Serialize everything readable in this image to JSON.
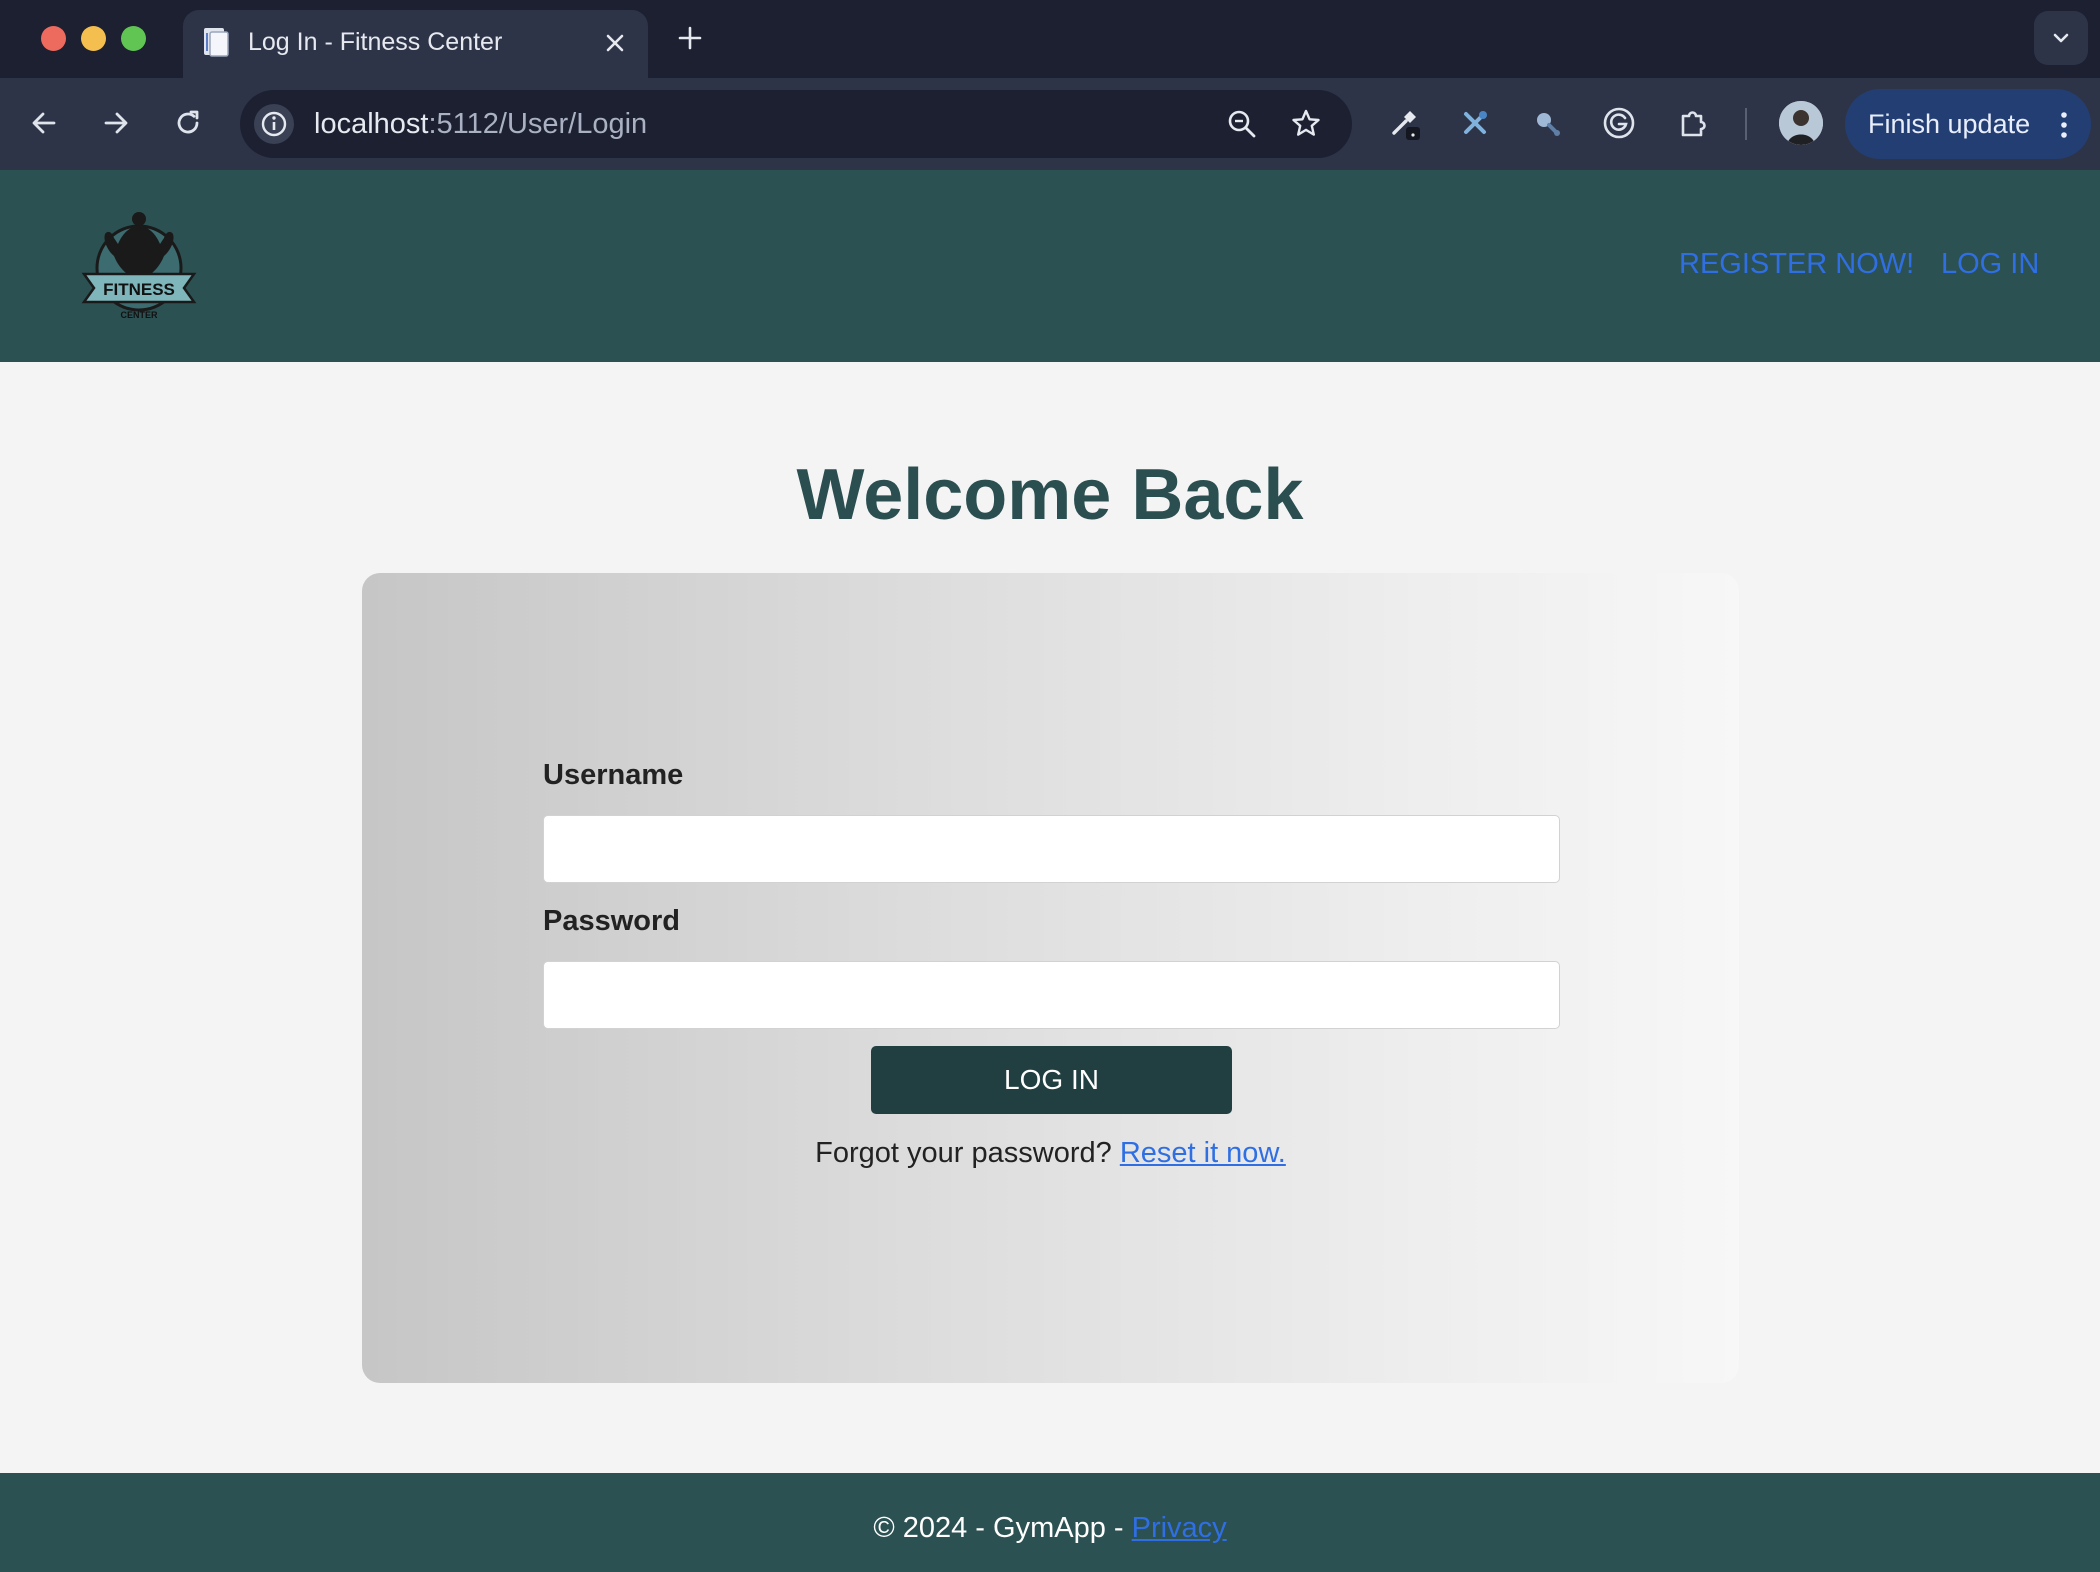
{
  "browser": {
    "tab_title": "Log In - Fitness Center",
    "url_host": "localhost",
    "url_path": ":5112/User/Login",
    "update_label": "Finish update",
    "icons": {
      "close": "close-icon",
      "new_tab": "plus-icon",
      "tab_search": "chevron-down-icon",
      "back": "arrow-left-icon",
      "forward": "arrow-right-icon",
      "reload": "reload-icon",
      "site_info": "info-icon",
      "zoom": "zoom-out-icon",
      "bookmark": "star-icon",
      "extensions": [
        "eyedropper-extension-icon",
        "tools-extension-icon",
        "search-extension-icon",
        "grammarly-extension-icon",
        "puzzle-extensions-icon"
      ],
      "menu": "vertical-dots-icon"
    }
  },
  "header": {
    "logo_text": "FITNESS",
    "logo_subtext": "CENTER",
    "nav": {
      "register": "REGISTER NOW!",
      "login": "LOG IN"
    }
  },
  "main": {
    "heading": "Welcome Back",
    "form": {
      "username_label": "Username",
      "username_value": "",
      "password_label": "Password",
      "password_value": "",
      "submit_label": "LOG IN",
      "forgot_text": "Forgot your password?",
      "reset_link": "Reset it now."
    }
  },
  "footer": {
    "text": "© 2024 - GymApp - ",
    "privacy_link": "Privacy"
  },
  "colors": {
    "brand_teal": "#2c5152",
    "button_dark": "#213f41",
    "link_blue": "#2f6fe3",
    "heading": "#2b4f50"
  }
}
